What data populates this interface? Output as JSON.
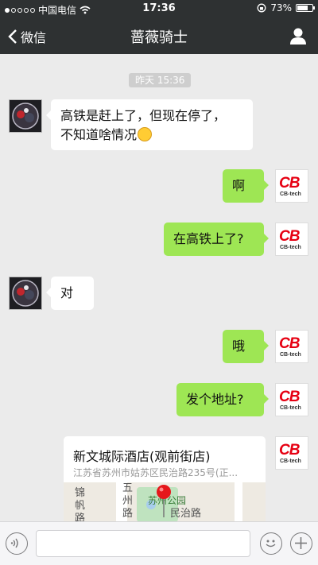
{
  "status_bar": {
    "carrier": "中国电信",
    "time": "17:36",
    "battery": "73%",
    "battery_level": 0.73
  },
  "nav": {
    "back_label": "微信",
    "title": "蔷薇骑士"
  },
  "chat": {
    "timestamp": "昨天 15:36",
    "messages": [
      {
        "sender": "friend",
        "line1": "高铁是赶上了，但现在停了，",
        "line2": "不知道啥情况"
      },
      {
        "sender": "me",
        "text": "啊"
      },
      {
        "sender": "me",
        "text": "在高铁上了?"
      },
      {
        "sender": "friend",
        "text": "对"
      },
      {
        "sender": "me",
        "text": "哦"
      },
      {
        "sender": "me",
        "text": "发个地址?"
      }
    ],
    "location": {
      "name": "新文城际酒店(观前街店)",
      "address": "江苏省苏州市姑苏区民治路235号(正...",
      "map_labels": {
        "a": "锦",
        "b": "帆",
        "c": "路",
        "d": "五",
        "e": "州",
        "f": "路",
        "g": "苏州公园",
        "h": "民治路"
      }
    },
    "my_avatar": {
      "logo": "CB",
      "sub": "CB-tech"
    }
  }
}
